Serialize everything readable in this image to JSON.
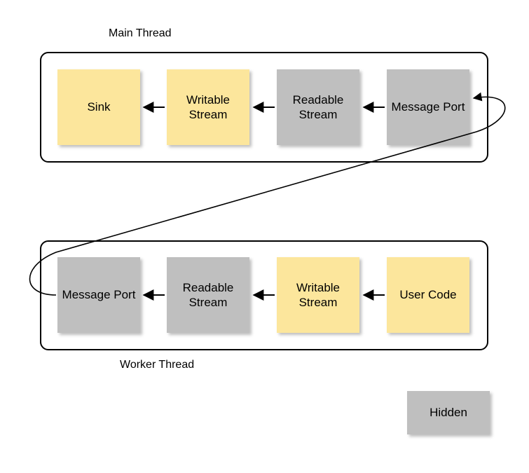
{
  "labels": {
    "main_thread": "Main Thread",
    "worker_thread": "Worker Thread",
    "legend_hidden": "Hidden"
  },
  "main": {
    "n0": "Sink",
    "n1": "Writable Stream",
    "n2": "Readable Stream",
    "n3": "Message Port"
  },
  "worker": {
    "n0": "Message Port",
    "n1": "Readable Stream",
    "n2": "Writable Stream",
    "n3": "User Code"
  },
  "chart_data": {
    "type": "diagram",
    "title": "",
    "containers": [
      {
        "id": "main",
        "label": "Main Thread",
        "label_pos": "above"
      },
      {
        "id": "worker",
        "label": "Worker Thread",
        "label_pos": "below"
      }
    ],
    "nodes": [
      {
        "id": "m_sink",
        "container": "main",
        "order": 0,
        "label": "Sink",
        "color": "yellow"
      },
      {
        "id": "m_writable",
        "container": "main",
        "order": 1,
        "label": "Writable Stream",
        "color": "yellow"
      },
      {
        "id": "m_readable",
        "container": "main",
        "order": 2,
        "label": "Readable Stream",
        "color": "gray"
      },
      {
        "id": "m_port",
        "container": "main",
        "order": 3,
        "label": "Message Port",
        "color": "gray"
      },
      {
        "id": "w_port",
        "container": "worker",
        "order": 0,
        "label": "Message Port",
        "color": "gray"
      },
      {
        "id": "w_readable",
        "container": "worker",
        "order": 1,
        "label": "Readable Stream",
        "color": "gray"
      },
      {
        "id": "w_writable",
        "container": "worker",
        "order": 2,
        "label": "Writable Stream",
        "color": "yellow"
      },
      {
        "id": "w_user",
        "container": "worker",
        "order": 3,
        "label": "User Code",
        "color": "yellow"
      }
    ],
    "edges": [
      {
        "from": "m_writable",
        "to": "m_sink"
      },
      {
        "from": "m_readable",
        "to": "m_writable"
      },
      {
        "from": "m_port",
        "to": "m_readable"
      },
      {
        "from": "w_readable",
        "to": "w_port"
      },
      {
        "from": "w_writable",
        "to": "w_readable"
      },
      {
        "from": "w_user",
        "to": "w_writable"
      },
      {
        "from": "w_port",
        "to": "m_port",
        "note": "cross-thread loop"
      }
    ],
    "legend": [
      {
        "label": "Hidden",
        "color": "gray"
      }
    ]
  }
}
